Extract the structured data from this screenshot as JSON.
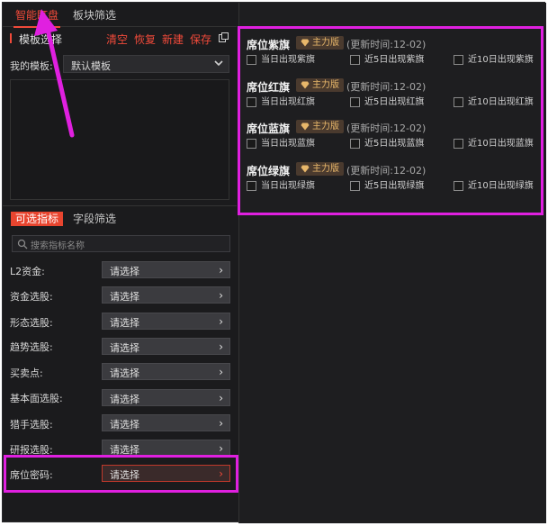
{
  "top_tabs": [
    {
      "label": "智能盯盘",
      "active": true
    },
    {
      "label": "板块筛选",
      "active": false
    }
  ],
  "template_section": {
    "title": "模板选择",
    "actions": [
      "清空",
      "恢复",
      "新建",
      "保存"
    ],
    "my_template_label": "我的模板:",
    "selected_template": "默认模板"
  },
  "sub_tabs": [
    {
      "label": "可选指标",
      "active": true
    },
    {
      "label": "字段筛选",
      "active": false
    }
  ],
  "search": {
    "placeholder": "搜索指标名称"
  },
  "indicator_rows": [
    {
      "label": "L2资金:",
      "button": "请选择"
    },
    {
      "label": "资金选股:",
      "button": "请选择"
    },
    {
      "label": "形态选股:",
      "button": "请选择"
    },
    {
      "label": "趋势选股:",
      "button": "请选择"
    },
    {
      "label": "买卖点:",
      "button": "请选择"
    },
    {
      "label": "基本面选股:",
      "button": "请选择"
    },
    {
      "label": "猎手选股:",
      "button": "请选择"
    },
    {
      "label": "研报选股:",
      "button": "请选择"
    },
    {
      "label": "席位密码:",
      "button": "请选择"
    }
  ],
  "arrow_glyph": "›",
  "flag_groups": [
    {
      "title": "席位紫旗",
      "badge": "主力版",
      "update": "(更新时间:12-02)",
      "options": [
        "当日出现紫旗",
        "近5日出现紫旗",
        "近10日出现紫旗"
      ]
    },
    {
      "title": "席位红旗",
      "badge": "主力版",
      "update": "(更新时间:12-02)",
      "options": [
        "当日出现红旗",
        "近5日出现红旗",
        "近10日出现红旗"
      ]
    },
    {
      "title": "席位蓝旗",
      "badge": "主力版",
      "update": "(更新时间:12-02)",
      "options": [
        "当日出现蓝旗",
        "近5日出现蓝旗",
        "近10日出现蓝旗"
      ]
    },
    {
      "title": "席位绿旗",
      "badge": "主力版",
      "update": "(更新时间:12-02)",
      "options": [
        "当日出现绿旗",
        "近5日出现绿旗",
        "近10日出现绿旗"
      ]
    }
  ],
  "colors": {
    "accent": "#f04a3a",
    "annotation": "#e020e0",
    "badge_text": "#e8b76a"
  }
}
